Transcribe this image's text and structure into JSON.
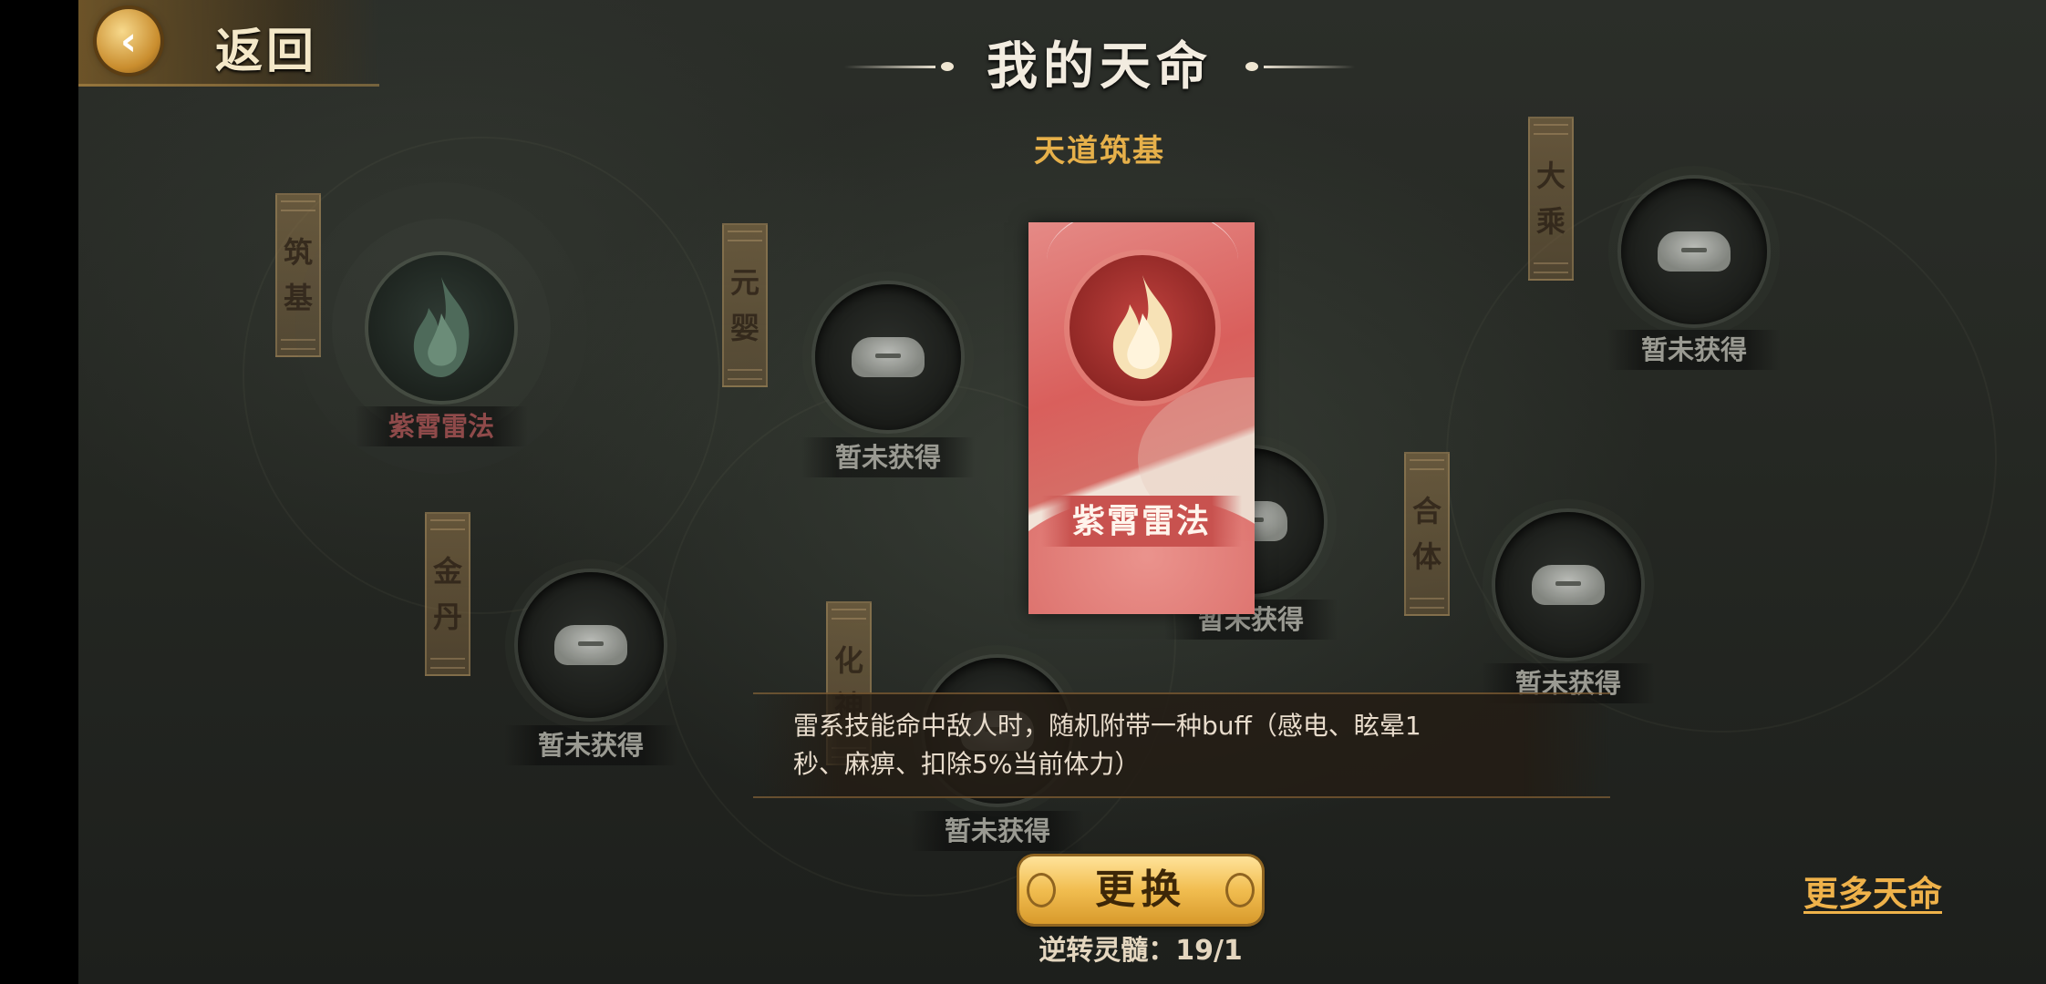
{
  "header": {
    "back_label": "返回",
    "title": "我的天命",
    "subtitle": "天道筑基"
  },
  "stages": [
    {
      "name": "筑基",
      "chars": [
        "筑",
        "基"
      ]
    },
    {
      "name": "元婴",
      "chars": [
        "元",
        "婴"
      ]
    },
    {
      "name": "金丹",
      "chars": [
        "金",
        "丹"
      ]
    },
    {
      "name": "化神",
      "chars": [
        "化",
        "神"
      ]
    },
    {
      "name": "合体",
      "chars": [
        "合",
        "体"
      ]
    },
    {
      "name": "大乘",
      "chars": [
        "大",
        "乘"
      ]
    }
  ],
  "slots": {
    "zhuji": {
      "label": "紫霄雷法",
      "owned": true
    },
    "yuanying": {
      "label": "暂未获得"
    },
    "jindan": {
      "label": "暂未获得"
    },
    "huashen": {
      "label": "暂未获得"
    },
    "center_right": {
      "label": "暂未获得"
    },
    "heti": {
      "label": "暂未获得"
    },
    "dacheng": {
      "label": "暂未获得"
    }
  },
  "selected_card": {
    "name": "紫霄雷法",
    "description_line1": "雷系技能命中敌人时，随机附带一种buff（感电、眩晕1",
    "description_line2": "秒、麻痹、扣除5%当前体力）"
  },
  "actions": {
    "change_label": "更换",
    "cost_text": "逆转灵髓：19/1",
    "more_label": "更多天命"
  },
  "colors": {
    "accent_gold": "#e6b04a",
    "card_red": "#d95f5c",
    "button_gold": "#f1bd50"
  }
}
